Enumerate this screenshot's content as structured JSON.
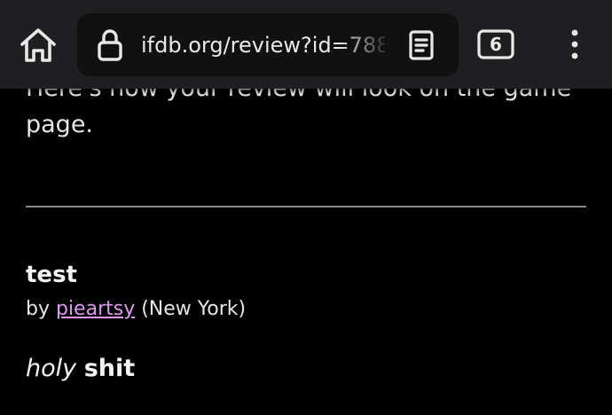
{
  "browser": {
    "url": "ifdb.org/review?id=788",
    "tab_count": "6",
    "icons": {
      "home": "home-icon",
      "lock": "lock-icon",
      "reader": "reader-mode-icon",
      "tabs": "tab-switcher-icon",
      "menu": "more-vert-icon"
    }
  },
  "page": {
    "intro_line_1": "Here's how your review will look on the game",
    "intro_line_2": "page."
  },
  "review": {
    "title": "test",
    "by_prefix": "by ",
    "author": "pieartsy",
    "location": " (New York)",
    "body_italic": "holy",
    "body_space": " ",
    "body_bold": "shit"
  },
  "colors": {
    "background": "#000000",
    "toolbar": "#1f1f21",
    "url_bar": "#111112",
    "link": "#dd99ee",
    "divider": "#8a8a8a",
    "text": "#e6e6e6"
  }
}
